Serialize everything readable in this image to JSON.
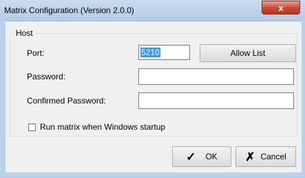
{
  "window": {
    "title": "Matrix Configuration (Version 2.0.0)",
    "close_glyph": "x"
  },
  "host": {
    "group_label": "Host",
    "port_label": "Port:",
    "port_value": "5210",
    "allow_list_label": "Allow List",
    "password_label": "Password:",
    "password_value": "",
    "confirmed_password_label": "Confirmed Password:",
    "confirmed_password_value": "",
    "startup_checkbox_label": "Run matrix when Windows startup",
    "startup_checked": false
  },
  "actions": {
    "ok_label": "OK",
    "cancel_label": "Cancel"
  },
  "icons": {
    "ok": "checkmark-icon",
    "cancel": "x-mark-icon"
  }
}
